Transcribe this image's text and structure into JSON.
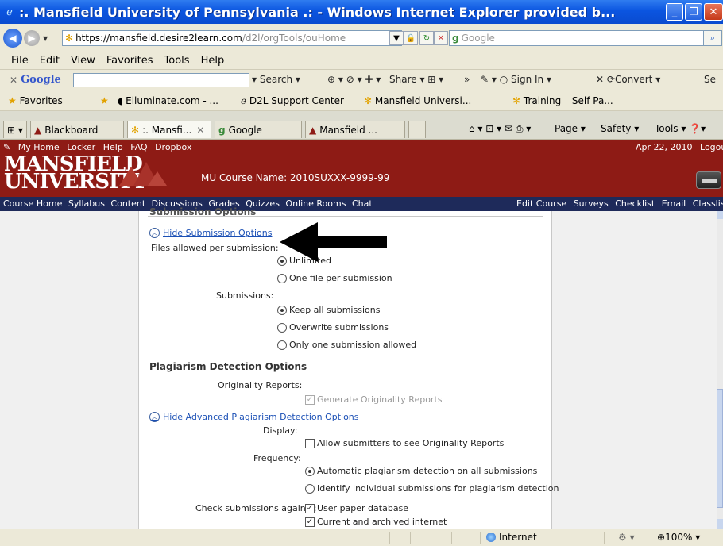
{
  "window": {
    "title": ":. Mansfield University of Pennsylvania .: - Windows Internet Explorer provided b..."
  },
  "address": {
    "scheme": "https://",
    "host": "mansfield.desire2learn.com",
    "path": "/d2l/orgTools/ouHome",
    "search_placeholder": "Google"
  },
  "menu": {
    "items": [
      "File",
      "Edit",
      "View",
      "Favorites",
      "Tools",
      "Help"
    ]
  },
  "google_toolbar": {
    "logo": "Google",
    "search": "Search",
    "share": "Share",
    "more": "»",
    "signin": "Sign In",
    "convert": "Convert",
    "cut": "Se"
  },
  "favorites": {
    "label": "Favorites",
    "items": [
      "Elluminate.com - ...",
      "D2L Support Center",
      "Mansfield Universi...",
      "Training _ Self Pa..."
    ]
  },
  "tabs": {
    "items": [
      "Blackboard",
      ":. Mansfi...",
      "Google",
      "Mansfield ..."
    ],
    "commands": [
      "Page",
      "Safety",
      "Tools"
    ]
  },
  "header": {
    "toplinks": [
      "My Home",
      "Locker",
      "Help",
      "FAQ",
      "Dropbox"
    ],
    "date": "Apr 22, 2010",
    "logout": "Logout",
    "logo_line1": "MANSFIELD",
    "logo_line2": "UNIVERSITY",
    "course_name": "MU Course Name: 2010SUXXX-9999-99"
  },
  "course_nav": {
    "left": [
      "Course Home",
      "Syllabus",
      "Content",
      "Discussions",
      "Grades",
      "Quizzes",
      "Online Rooms",
      "Chat"
    ],
    "right": [
      "Edit Course",
      "Surveys",
      "Checklist",
      "Email",
      "Classlist"
    ]
  },
  "form": {
    "clipped_heading": "Submission Options",
    "hide_submission": "Hide Submission Options",
    "files_allowed_label": "Files allowed per submission:",
    "files_opts": [
      "Unlimited",
      "One file per submission"
    ],
    "submissions_label": "Submissions:",
    "submission_opts": [
      "Keep all submissions",
      "Overwrite submissions",
      "Only one submission allowed"
    ],
    "plagiarism_title": "Plagiarism Detection Options",
    "originality_label": "Originality Reports:",
    "originality_opt": "Generate Originality Reports",
    "hide_advanced": "Hide Advanced Plagiarism Detection Options",
    "display_label": "Display:",
    "display_opt": "Allow submitters to see Originality Reports",
    "frequency_label": "Frequency:",
    "frequency_opts": [
      "Automatic plagiarism detection on all submissions",
      "Identify individual submissions for plagiarism detection"
    ],
    "check_label": "Check submissions against:",
    "check_opts": [
      "User paper database",
      "Current and archived internet"
    ]
  },
  "status": {
    "zone": "Internet",
    "zoom": "100%"
  },
  "colors": {
    "brand_red": "#8e1b15",
    "nav_blue": "#1e2a5a",
    "link_blue": "#1a4fb5"
  }
}
